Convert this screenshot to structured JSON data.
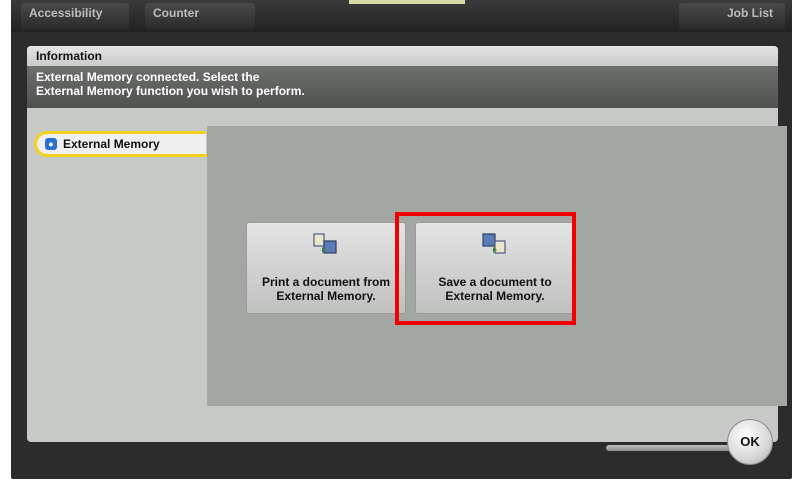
{
  "top_bar": {
    "accessibility_label": "Accessibility",
    "counter_label": "Counter",
    "job_list_label": "Job List"
  },
  "information": {
    "title": "Information",
    "message_line1": "External Memory connected. Select the",
    "message_line2": "External Memory function you wish to perform."
  },
  "side_tab": {
    "label": "External Memory",
    "icon": "usb-memory-icon"
  },
  "functions": [
    {
      "line1": "Print a document from",
      "line2": "External Memory.",
      "icon": "print-document-icon"
    },
    {
      "line1": "Save a document to",
      "line2": "External Memory.",
      "icon": "save-document-icon",
      "highlighted": true
    }
  ],
  "ok_label": "OK",
  "colors": {
    "highlight": "#f00000",
    "tab_accent": "#f2d21a"
  }
}
